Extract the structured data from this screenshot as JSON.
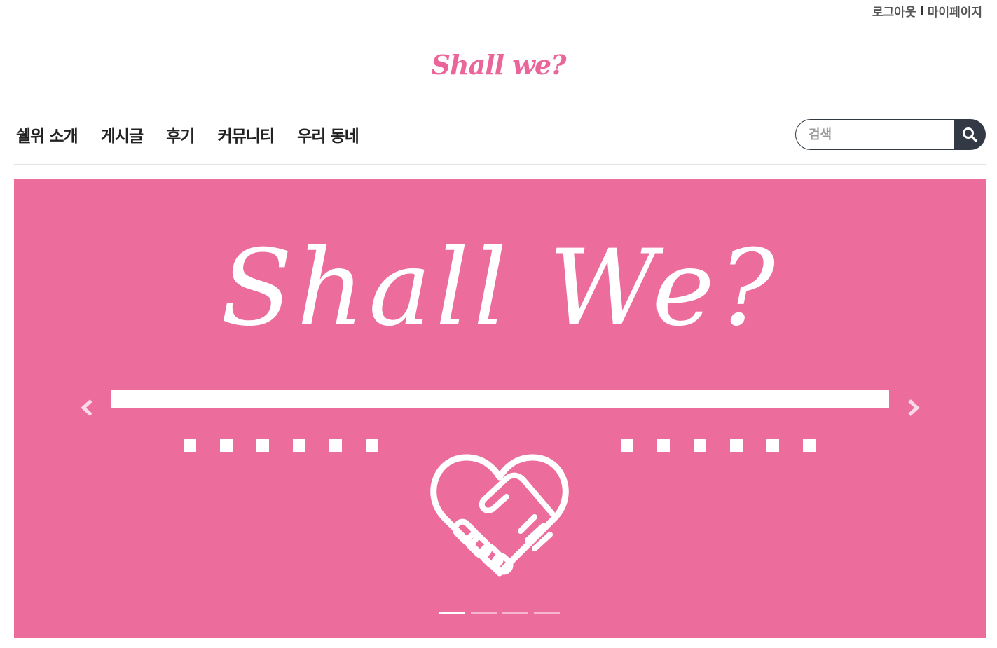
{
  "top_links": {
    "logout": "로그아웃",
    "separator": "I",
    "mypage": "마이페이지"
  },
  "logo": "Shall we?",
  "nav": {
    "items": [
      {
        "label": "쉘위 소개"
      },
      {
        "label": "게시글"
      },
      {
        "label": "후기"
      },
      {
        "label": "커뮤니티"
      },
      {
        "label": "우리 동네"
      }
    ]
  },
  "search": {
    "placeholder": "검색",
    "icon": "search-icon"
  },
  "banner": {
    "title": "Shall We?",
    "slide_count": 4,
    "active_slide": 1
  },
  "colors": {
    "brand": "#e9659a",
    "banner_bg": "#ec6d9c",
    "search_button": "#343a45"
  }
}
